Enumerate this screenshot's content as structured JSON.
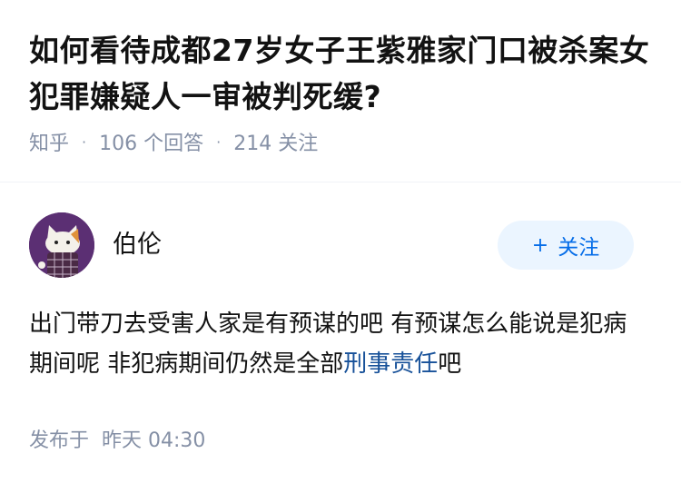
{
  "question": {
    "title": "如何看待成都27岁女子王紫雅家门口被杀案女犯罪嫌疑人一审被判死缓?",
    "source": "知乎",
    "answer_count": "106 个回答",
    "follower_count": "214 关注"
  },
  "answer": {
    "author_name": "伯伦",
    "follow_label": "关注",
    "follow_icon": "plus-icon",
    "content_text": "出门带刀去受害人家是有预谋的吧 有预谋怎么能说是犯病期间呢 非犯病期间仍然是全部",
    "content_link": "刑事责任",
    "content_suffix": "吧",
    "published_label": "发布于",
    "published_time": "昨天 04:30"
  },
  "colors": {
    "primary": "#056de8",
    "follow_bg": "#ebf5ff",
    "link": "#175199",
    "meta_text": "#8590a6",
    "avatar_bg": "#5b2f73"
  }
}
